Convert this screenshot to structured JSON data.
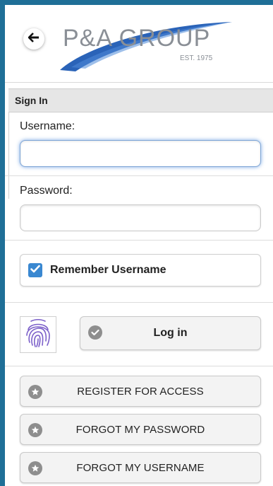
{
  "header": {
    "brand_name": "P&A GROUP",
    "brand_tagline": "EST. 1975"
  },
  "signin": {
    "section_title": "Sign In",
    "username_label": "Username:",
    "username_value": "",
    "password_label": "Password:",
    "password_value": "",
    "remember_label": "Remember Username",
    "remember_checked": true,
    "login_label": "Log in"
  },
  "links": [
    {
      "label": "REGISTER FOR ACCESS"
    },
    {
      "label": "FORGOT MY PASSWORD"
    },
    {
      "label": "FORGOT MY USERNAME"
    }
  ],
  "colors": {
    "frame": "#1f6f97",
    "logo_text": "#8a8f96",
    "logo_swoosh": "#2a63b8",
    "checkbox": "#3a88d1"
  },
  "icons": {
    "back": "arrow-left-icon",
    "check": "check-icon",
    "login": "check-circle-icon",
    "links": "star-circle-icon",
    "fingerprint": "fingerprint-icon"
  }
}
